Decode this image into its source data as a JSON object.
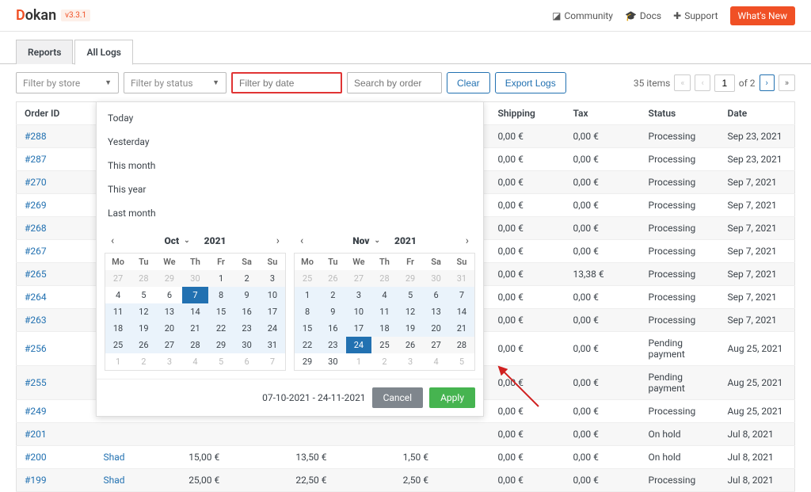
{
  "brand": {
    "part1": "D",
    "part2": "okan",
    "version": "v3.3.1"
  },
  "topnav": {
    "community": "Community",
    "docs": "Docs",
    "support": "Support",
    "whats_new": "What's New"
  },
  "tabs": {
    "reports": "Reports",
    "all_logs": "All Logs"
  },
  "filters": {
    "store_ph": "Filter by store",
    "status_ph": "Filter by status",
    "date_ph": "Filter by date",
    "search_ph": "Search by order",
    "clear": "Clear",
    "export": "Export Logs"
  },
  "pager": {
    "count": "35 items",
    "current": "1",
    "of": "of 2"
  },
  "columns": {
    "order": "Order ID",
    "shipping": "Shipping",
    "tax": "Tax",
    "status": "Status",
    "date": "Date"
  },
  "rows": [
    {
      "order": "#288",
      "shipping": "0,00 €",
      "tax": "0,00 €",
      "status": "Processing",
      "date": "Sep 23, 2021"
    },
    {
      "order": "#287",
      "shipping": "0,00 €",
      "tax": "0,00 €",
      "status": "Processing",
      "date": "Sep 23, 2021"
    },
    {
      "order": "#270",
      "shipping": "0,00 €",
      "tax": "0,00 €",
      "status": "Processing",
      "date": "Sep 7, 2021"
    },
    {
      "order": "#269",
      "shipping": "0,00 €",
      "tax": "0,00 €",
      "status": "Processing",
      "date": "Sep 7, 2021"
    },
    {
      "order": "#268",
      "shipping": "0,00 €",
      "tax": "0,00 €",
      "status": "Processing",
      "date": "Sep 7, 2021"
    },
    {
      "order": "#267",
      "shipping": "0,00 €",
      "tax": "0,00 €",
      "status": "Processing",
      "date": "Sep 7, 2021"
    },
    {
      "order": "#265",
      "shipping": "0,00 €",
      "tax": "13,38 €",
      "status": "Processing",
      "date": "Sep 7, 2021"
    },
    {
      "order": "#264",
      "shipping": "0,00 €",
      "tax": "0,00 €",
      "status": "Processing",
      "date": "Sep 7, 2021"
    },
    {
      "order": "#263",
      "shipping": "0,00 €",
      "tax": "0,00 €",
      "status": "Processing",
      "date": "Sep 7, 2021"
    },
    {
      "order": "#256",
      "shipping": "0,00 €",
      "tax": "0,00 €",
      "status": "Pending payment",
      "date": "Aug 25, 2021"
    },
    {
      "order": "#255",
      "shipping": "0,00 €",
      "tax": "0,00 €",
      "status": "Pending payment",
      "date": "Aug 25, 2021"
    },
    {
      "order": "#249",
      "shipping": "0,00 €",
      "tax": "0,00 €",
      "status": "Processing",
      "date": "Aug 25, 2021"
    },
    {
      "order": "#201",
      "shipping": "0,00 €",
      "tax": "0,00 €",
      "status": "On hold",
      "date": "Jul 8, 2021"
    }
  ],
  "rows_full": [
    {
      "order": "#200",
      "vendor": "Shad",
      "c1": "15,00 €",
      "c2": "13,50 €",
      "c3": "1,50 €",
      "shipping": "0,00 €",
      "tax": "0,00 €",
      "status": "On hold",
      "date": "Jul 8, 2021"
    },
    {
      "order": "#199",
      "vendor": "Shad",
      "c1": "25,00 €",
      "c2": "22,50 €",
      "c3": "2,50 €",
      "shipping": "0,00 €",
      "tax": "0,00 €",
      "status": "Processing",
      "date": "Jul 8, 2021"
    }
  ],
  "dp": {
    "presets": [
      "Today",
      "Yesterday",
      "This month",
      "This year",
      "Last month"
    ],
    "left": {
      "month": "Oct",
      "year": "2021",
      "dow": [
        "Mo",
        "Tu",
        "We",
        "Th",
        "Fr",
        "Sa",
        "Su"
      ],
      "weeks": [
        [
          {
            "d": 27,
            "m": 1
          },
          {
            "d": 28,
            "m": 1
          },
          {
            "d": 29,
            "m": 1
          },
          {
            "d": 30,
            "m": 1
          },
          {
            "d": 1
          },
          {
            "d": 2
          },
          {
            "d": 3
          }
        ],
        [
          {
            "d": 4
          },
          {
            "d": 5
          },
          {
            "d": 6
          },
          {
            "d": 7,
            "sel": 1
          },
          {
            "d": 8,
            "r": 1
          },
          {
            "d": 9,
            "r": 1
          },
          {
            "d": 10,
            "r": 1
          }
        ],
        [
          {
            "d": 11,
            "r": 1
          },
          {
            "d": 12,
            "r": 1
          },
          {
            "d": 13,
            "r": 1
          },
          {
            "d": 14,
            "r": 1
          },
          {
            "d": 15,
            "r": 1
          },
          {
            "d": 16,
            "r": 1
          },
          {
            "d": 17,
            "r": 1
          }
        ],
        [
          {
            "d": 18,
            "r": 1
          },
          {
            "d": 19,
            "r": 1
          },
          {
            "d": 20,
            "r": 1
          },
          {
            "d": 21,
            "r": 1
          },
          {
            "d": 22,
            "r": 1
          },
          {
            "d": 23,
            "r": 1
          },
          {
            "d": 24,
            "r": 1
          }
        ],
        [
          {
            "d": 25,
            "r": 1
          },
          {
            "d": 26,
            "r": 1
          },
          {
            "d": 27,
            "r": 1
          },
          {
            "d": 28,
            "r": 1
          },
          {
            "d": 29,
            "r": 1
          },
          {
            "d": 30,
            "r": 1
          },
          {
            "d": 31,
            "r": 1
          }
        ],
        [
          {
            "d": 1,
            "m": 1
          },
          {
            "d": 2,
            "m": 1
          },
          {
            "d": 3,
            "m": 1
          },
          {
            "d": 4,
            "m": 1
          },
          {
            "d": 5,
            "m": 1
          },
          {
            "d": 6,
            "m": 1
          },
          {
            "d": 7,
            "m": 1
          }
        ]
      ]
    },
    "right": {
      "month": "Nov",
      "year": "2021",
      "dow": [
        "Mo",
        "Tu",
        "We",
        "Th",
        "Fr",
        "Sa",
        "Su"
      ],
      "weeks": [
        [
          {
            "d": 25,
            "m": 1
          },
          {
            "d": 26,
            "m": 1
          },
          {
            "d": 27,
            "m": 1
          },
          {
            "d": 28,
            "m": 1
          },
          {
            "d": 29,
            "m": 1
          },
          {
            "d": 30,
            "m": 1
          },
          {
            "d": 31,
            "m": 1
          }
        ],
        [
          {
            "d": 1,
            "r": 1
          },
          {
            "d": 2,
            "r": 1
          },
          {
            "d": 3,
            "r": 1
          },
          {
            "d": 4,
            "r": 1
          },
          {
            "d": 5,
            "r": 1
          },
          {
            "d": 6,
            "r": 1
          },
          {
            "d": 7,
            "r": 1
          }
        ],
        [
          {
            "d": 8,
            "r": 1
          },
          {
            "d": 9,
            "r": 1
          },
          {
            "d": 10,
            "r": 1
          },
          {
            "d": 11,
            "r": 1
          },
          {
            "d": 12,
            "r": 1
          },
          {
            "d": 13,
            "r": 1
          },
          {
            "d": 14,
            "r": 1
          }
        ],
        [
          {
            "d": 15,
            "r": 1
          },
          {
            "d": 16,
            "r": 1
          },
          {
            "d": 17,
            "r": 1
          },
          {
            "d": 18,
            "r": 1
          },
          {
            "d": 19,
            "r": 1
          },
          {
            "d": 20,
            "r": 1
          },
          {
            "d": 21,
            "r": 1
          }
        ],
        [
          {
            "d": 22,
            "r": 1
          },
          {
            "d": 23,
            "r": 1
          },
          {
            "d": 24,
            "sel": 1
          },
          {
            "d": 25
          },
          {
            "d": 26
          },
          {
            "d": 27
          },
          {
            "d": 28
          }
        ],
        [
          {
            "d": 29
          },
          {
            "d": 30
          },
          {
            "d": 1,
            "m": 1
          },
          {
            "d": 2,
            "m": 1
          },
          {
            "d": 3,
            "m": 1
          },
          {
            "d": 4,
            "m": 1
          },
          {
            "d": 5,
            "m": 1
          }
        ]
      ]
    },
    "range": "07-10-2021 - 24-11-2021",
    "cancel": "Cancel",
    "apply": "Apply"
  }
}
